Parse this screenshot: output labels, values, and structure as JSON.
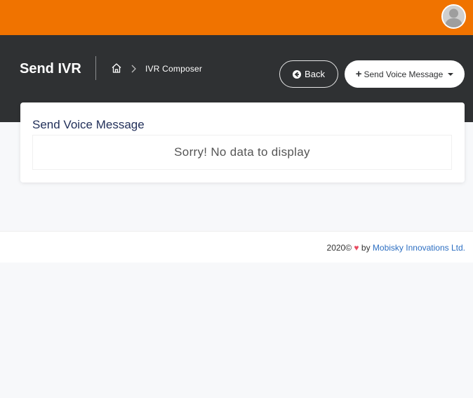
{
  "header": {
    "title": "Send IVR",
    "breadcrumb": {
      "home_icon": "home-icon",
      "separator_icon": "chevron-right-icon",
      "current": "IVR Composer"
    },
    "back_button": {
      "label": "Back",
      "icon": "circle-arrow-left-icon"
    },
    "send_button": {
      "label": "Send Voice Message",
      "icon": "plus-icon"
    }
  },
  "card": {
    "title": "Send Voice Message",
    "empty_message": "Sorry! No data to display"
  },
  "footer": {
    "year": "2020©",
    "heart": "♥",
    "by": "by",
    "company": "Mobisky Innovations Ltd."
  },
  "colors": {
    "topbar": "#f07300",
    "header": "#2f3133",
    "card_title": "#22305a",
    "link": "#2d6fc2",
    "heart": "#e84a5f"
  }
}
